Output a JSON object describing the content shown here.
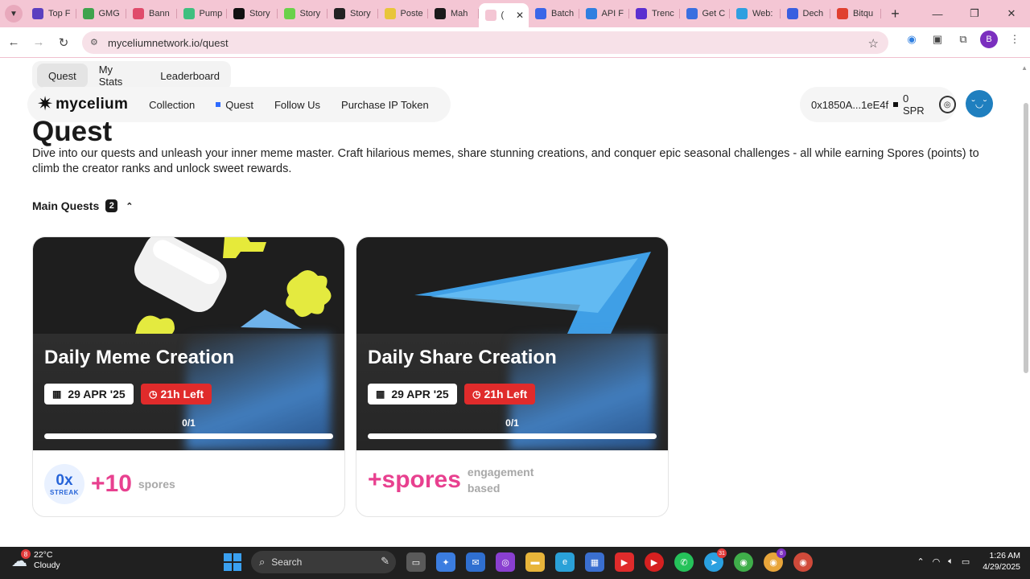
{
  "browser": {
    "tabs": [
      {
        "label": "Top F",
        "color": "#5b3fbf"
      },
      {
        "label": "GMG",
        "color": "#3fa34d"
      },
      {
        "label": "Bann",
        "color": "#e04b6b"
      },
      {
        "label": "Pump",
        "color": "#3fbf7f"
      },
      {
        "label": "Story",
        "color": "#111111"
      },
      {
        "label": "Story",
        "color": "#6ad14a"
      },
      {
        "label": "Story",
        "color": "#222222"
      },
      {
        "label": "Poste",
        "color": "#e8c53a"
      },
      {
        "label": "Mah",
        "color": "#1a1a1a"
      },
      {
        "label": "(",
        "color": "#f4c6d4",
        "active": true
      },
      {
        "label": "Batch",
        "color": "#3a66e8"
      },
      {
        "label": "API F",
        "color": "#2f7fe0"
      },
      {
        "label": "Trenc",
        "color": "#5b2fd0"
      },
      {
        "label": "Get C",
        "color": "#3a6fe0"
      },
      {
        "label": "Web:",
        "color": "#2f9fe0"
      },
      {
        "label": "Dech",
        "color": "#3a5fe0"
      },
      {
        "label": "Bitqu",
        "color": "#e0402f"
      }
    ],
    "url": "myceliumnetwork.io/quest",
    "profile_initial": "B"
  },
  "page": {
    "subtabs": [
      "Quest",
      "My Stats",
      "Leaderboard"
    ],
    "logo_text": "mycelium",
    "nav": [
      "Collection",
      "Quest",
      "Follow Us",
      "Purchase IP Token"
    ],
    "wallet_address": "0x1850A...1eE4f",
    "wallet_balance": "0 SPR",
    "title": "Quest",
    "description": "Dive into our quests and unleash your inner meme master. Craft hilarious memes, share stunning creations, and conquer epic seasonal challenges - all while earning Spores (points) to climb the creator ranks and unlock sweet rewards.",
    "section_title": "Main Quests",
    "section_count": "2",
    "quests": [
      {
        "title": "Daily Meme Creation",
        "date": "29 APR '25",
        "time_left": "21h Left",
        "progress_label": "0/1",
        "progress": 0,
        "streak_value": "0x",
        "streak_label": "STREAK",
        "reward": "+10",
        "reward_unit": "spores"
      },
      {
        "title": "Daily Share Creation",
        "date": "29 APR '25",
        "time_left": "21h Left",
        "progress_label": "0/1",
        "progress": 0,
        "reward": "+spores",
        "reward_note": "engagement based"
      }
    ]
  },
  "taskbar": {
    "weather_temp": "22°C",
    "weather_desc": "Cloudy",
    "weather_badge": "8",
    "search_placeholder": "Search",
    "telegram_badge": "31",
    "chrome_badge": "8",
    "time": "1:26 AM",
    "date": "4/29/2025"
  }
}
